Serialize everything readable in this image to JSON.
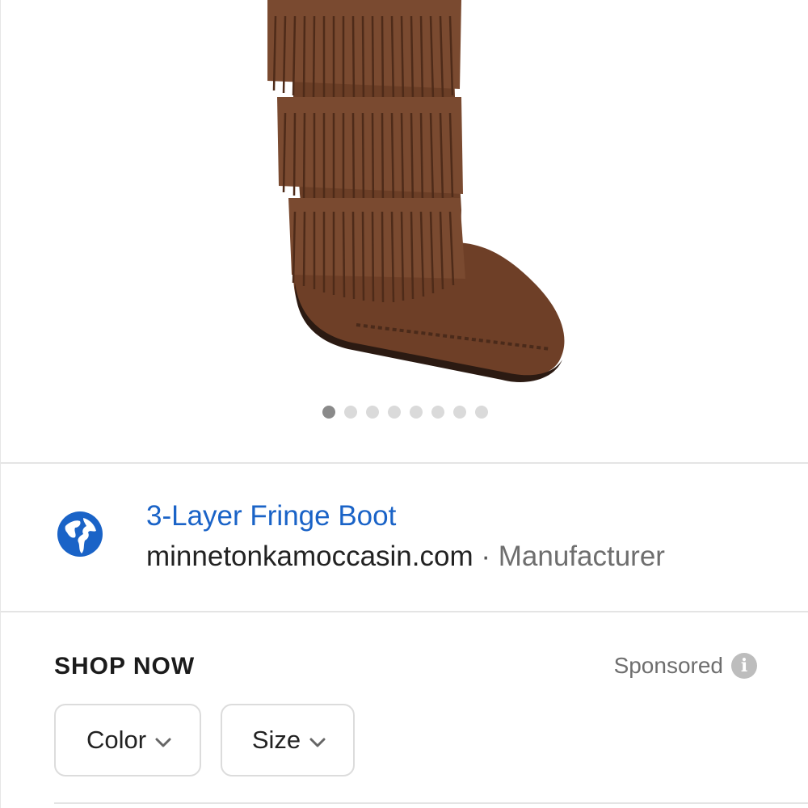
{
  "carousel": {
    "image_alt": "brown suede 3-layer fringe boot",
    "dot_count": 8,
    "active_index": 0
  },
  "result": {
    "title": "3-Layer Fringe Boot",
    "domain": "minnetonkamoccasin.com",
    "separator": " · ",
    "source_type": "Manufacturer",
    "icon": "globe-icon"
  },
  "shop": {
    "heading": "SHOP NOW",
    "sponsored_label": "Sponsored",
    "info_icon": "info-icon",
    "filters": [
      {
        "label": "Color",
        "icon": "chevron-down-icon"
      },
      {
        "label": "Size",
        "icon": "chevron-down-icon"
      }
    ]
  },
  "colors": {
    "link_blue": "#1a63c7",
    "boot_brown": "#6b3e26"
  }
}
